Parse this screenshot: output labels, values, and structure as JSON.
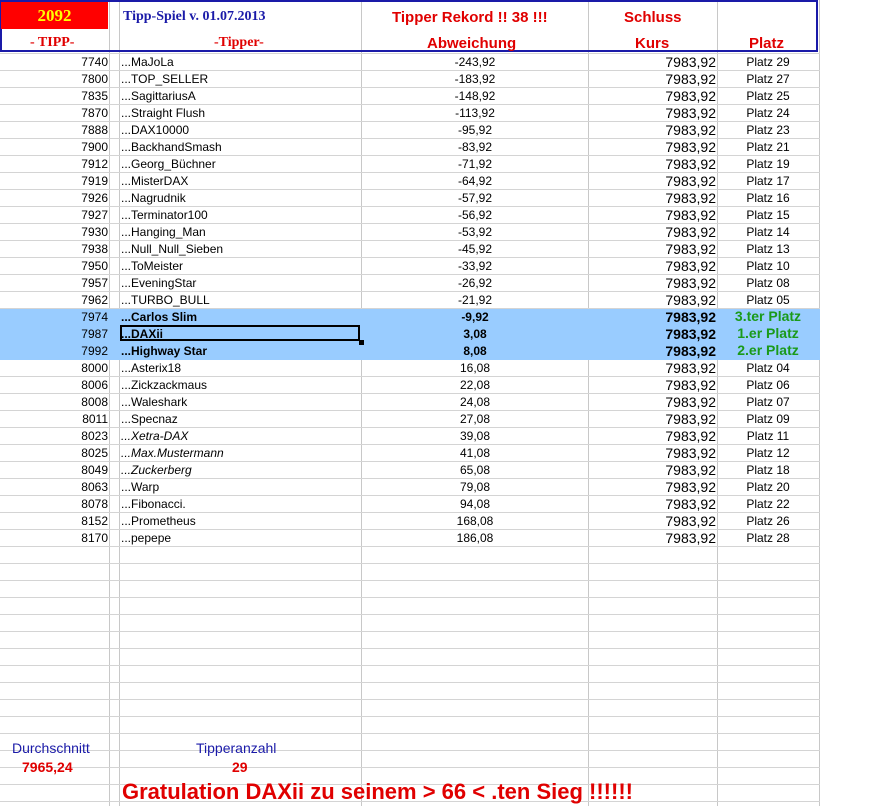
{
  "header": {
    "tipp_badge": "2092",
    "title": "Tipp-Spiel v. 01.07.2013",
    "rekord": "Tipper Rekord !!  38  !!!",
    "schluss": "Schluss",
    "col_tipp": "- TIPP-",
    "col_tipper": "-Tipper-",
    "col_abweichung": "Abweichung",
    "col_kurs": "Kurs",
    "col_platz": "Platz"
  },
  "rows": [
    {
      "tipp": "7740",
      "name": "...MaJoLa",
      "abw": "-243,92",
      "kurs": "7983,92",
      "platz": "Platz 29"
    },
    {
      "tipp": "7800",
      "name": "...TOP_SELLER",
      "abw": "-183,92",
      "kurs": "7983,92",
      "platz": "Platz 27"
    },
    {
      "tipp": "7835",
      "name": "...SagittariusA",
      "abw": "-148,92",
      "kurs": "7983,92",
      "platz": "Platz 25"
    },
    {
      "tipp": "7870",
      "name": "...Straight Flush",
      "abw": "-113,92",
      "kurs": "7983,92",
      "platz": "Platz 24"
    },
    {
      "tipp": "7888",
      "name": "...DAX10000",
      "abw": "-95,92",
      "kurs": "7983,92",
      "platz": "Platz 23"
    },
    {
      "tipp": "7900",
      "name": "...BackhandSmash",
      "abw": "-83,92",
      "kurs": "7983,92",
      "platz": "Platz 21"
    },
    {
      "tipp": "7912",
      "name": "...Georg_Büchner",
      "abw": "-71,92",
      "kurs": "7983,92",
      "platz": "Platz 19"
    },
    {
      "tipp": "7919",
      "name": "...MisterDAX",
      "abw": "-64,92",
      "kurs": "7983,92",
      "platz": "Platz 17"
    },
    {
      "tipp": "7926",
      "name": "...Nagrudnik",
      "abw": "-57,92",
      "kurs": "7983,92",
      "platz": "Platz 16"
    },
    {
      "tipp": "7927",
      "name": "...Terminator100",
      "abw": "-56,92",
      "kurs": "7983,92",
      "platz": "Platz 15"
    },
    {
      "tipp": "7930",
      "name": "...Hanging_Man",
      "abw": "-53,92",
      "kurs": "7983,92",
      "platz": "Platz 14"
    },
    {
      "tipp": "7938",
      "name": "...Null_Null_Sieben",
      "abw": "-45,92",
      "kurs": "7983,92",
      "platz": "Platz 13"
    },
    {
      "tipp": "7950",
      "name": "...ToMeister",
      "abw": "-33,92",
      "kurs": "7983,92",
      "platz": "Platz 10"
    },
    {
      "tipp": "7957",
      "name": "...EveningStar",
      "abw": "-26,92",
      "kurs": "7983,92",
      "platz": "Platz 08"
    },
    {
      "tipp": "7962",
      "name": "...TURBO_BULL",
      "abw": "-21,92",
      "kurs": "7983,92",
      "platz": "Platz 05"
    },
    {
      "tipp": "7974",
      "name": "...Carlos Slim",
      "abw": "-9,92",
      "kurs": "7983,92",
      "platz": "3.ter Platz",
      "hl": true
    },
    {
      "tipp": "7987",
      "name": "...DAXii",
      "abw": "3,08",
      "kurs": "7983,92",
      "platz": "1.er Platz",
      "hl": true
    },
    {
      "tipp": "7992",
      "name": "...Highway Star",
      "abw": "8,08",
      "kurs": "7983,92",
      "platz": "2.er Platz",
      "hl": true
    },
    {
      "tipp": "8000",
      "name": "...Asterix18",
      "abw": "16,08",
      "kurs": "7983,92",
      "platz": "Platz 04"
    },
    {
      "tipp": "8006",
      "name": "...Zickzackmaus",
      "abw": "22,08",
      "kurs": "7983,92",
      "platz": "Platz 06"
    },
    {
      "tipp": "8008",
      "name": "...Waleshark",
      "abw": "24,08",
      "kurs": "7983,92",
      "platz": "Platz 07"
    },
    {
      "tipp": "8011",
      "name": "...Specnaz",
      "abw": "27,08",
      "kurs": "7983,92",
      "platz": "Platz 09"
    },
    {
      "tipp": "8023",
      "name": "...Xetra-DAX",
      "abw": "39,08",
      "kurs": "7983,92",
      "platz": "Platz 11",
      "italic": true
    },
    {
      "tipp": "8025",
      "name": "...Max.Mustermann",
      "abw": "41,08",
      "kurs": "7983,92",
      "platz": "Platz 12",
      "italic": true
    },
    {
      "tipp": "8049",
      "name": "...Zuckerberg",
      "abw": "65,08",
      "kurs": "7983,92",
      "platz": "Platz 18",
      "italic": true
    },
    {
      "tipp": "8063",
      "name": "...Warp",
      "abw": "79,08",
      "kurs": "7983,92",
      "platz": "Platz 20"
    },
    {
      "tipp": "8078",
      "name": "...Fibonacci.",
      "abw": "94,08",
      "kurs": "7983,92",
      "platz": "Platz 22"
    },
    {
      "tipp": "8152",
      "name": "...Prometheus",
      "abw": "168,08",
      "kurs": "7983,92",
      "platz": "Platz 26"
    },
    {
      "tipp": "8170",
      "name": "...pepepe",
      "abw": "186,08",
      "kurs": "7983,92",
      "platz": "Platz 28"
    }
  ],
  "footer": {
    "durchschnitt_label": "Durchschnitt",
    "durchschnitt_value": "7965,24",
    "tipperanzahl_label": "Tipperanzahl",
    "tipperanzahl_value": "29",
    "gratulation": "Gratulation DAXii zu seinem > 66 < .ten Sieg !!!!!!"
  },
  "colors": {
    "header_border": "#1a1aa8",
    "badge_bg": "#ff0000",
    "badge_text": "#ffff00",
    "red_text": "#e00000",
    "blue_text": "#1a1aa8",
    "highlight_bg": "#99ccff",
    "winner_green": "#1a9a1a"
  }
}
